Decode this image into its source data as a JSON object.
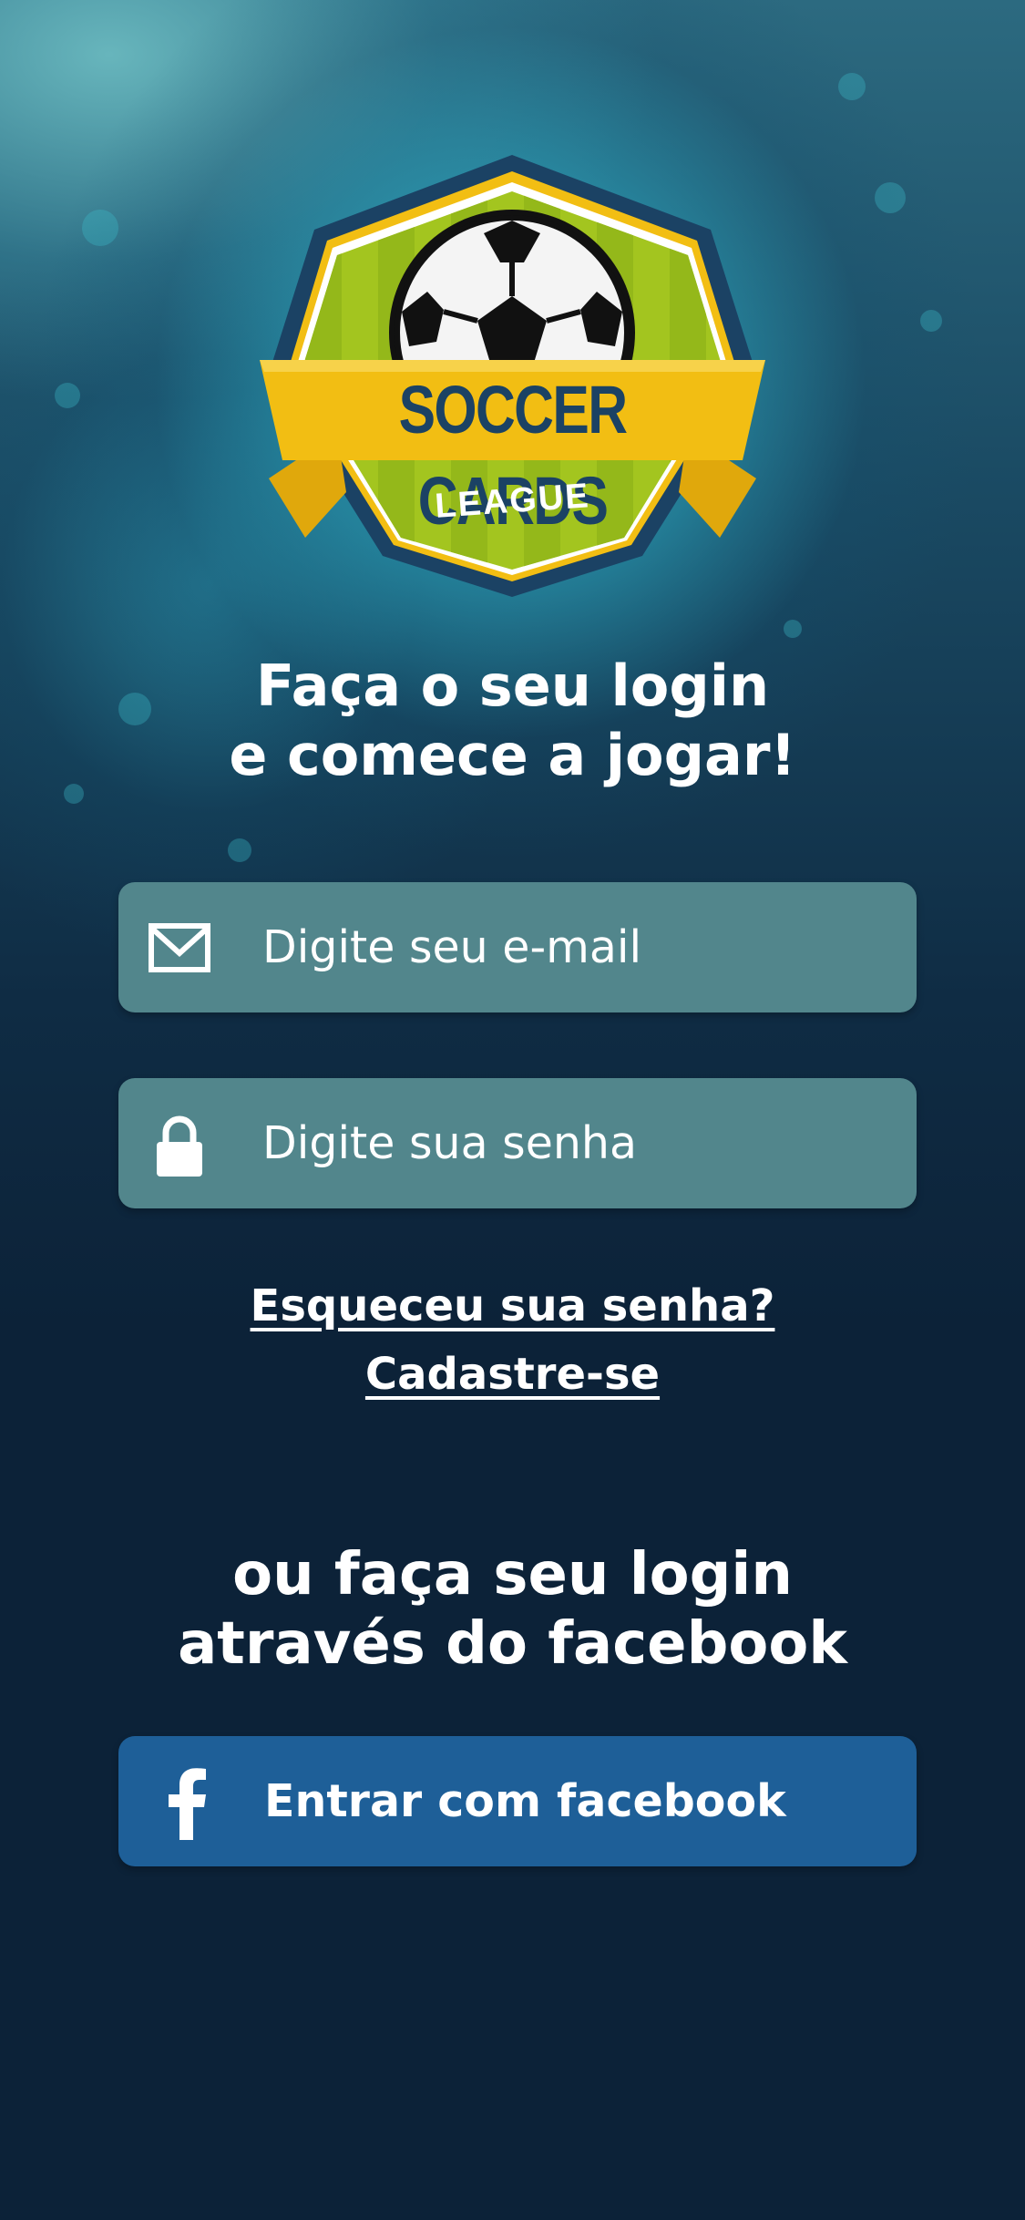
{
  "logo": {
    "name": "SOCCER CARDS",
    "subtitle": "LEAGUE"
  },
  "login": {
    "headline_line1": "Faça o seu login",
    "headline_line2": "e comece a jogar!",
    "email_placeholder": "Digite seu e-mail",
    "password_placeholder": "Digite sua senha",
    "forgot_password": "Esqueceu sua senha?",
    "register": "Cadastre-se"
  },
  "facebook": {
    "headline_line1": "ou faça seu login",
    "headline_line2": "através do facebook",
    "button_label": "Entrar com facebook"
  },
  "icons": {
    "email": "envelope-icon",
    "password": "lock-icon",
    "facebook": "facebook-icon",
    "logo_ball": "soccer-ball-icon"
  },
  "colors": {
    "background": "#0c2238",
    "field": "#52868c",
    "facebook_button": "#1e5f98",
    "logo_green": "#a3c51f",
    "logo_gold": "#f2be13",
    "logo_navy": "#1b4264"
  }
}
